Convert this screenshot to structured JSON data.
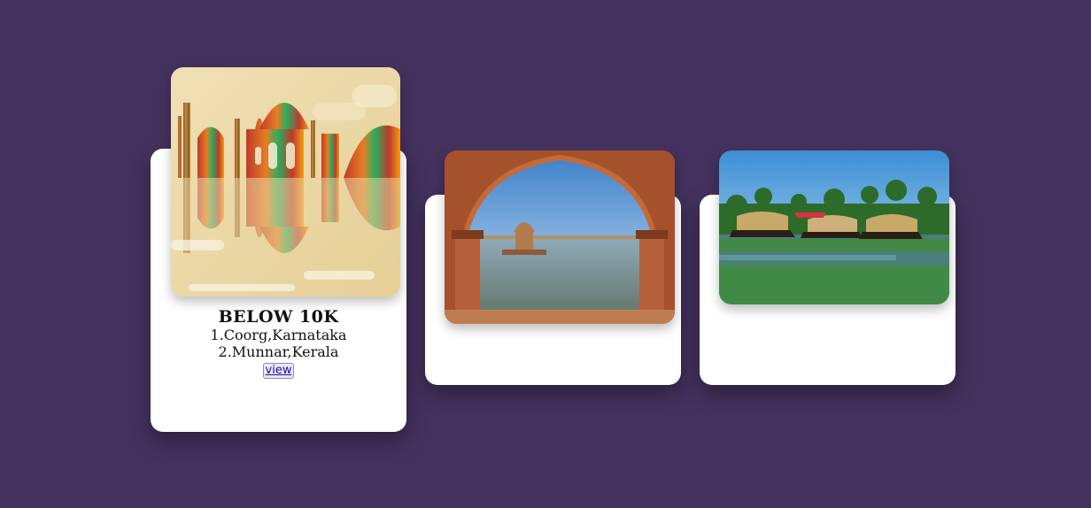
{
  "cards": [
    {
      "title": "BELOW 10K",
      "items": [
        "1.Coorg,Karnataka",
        "2.Munnar,Kerala"
      ],
      "button_label": "view"
    },
    {},
    {}
  ],
  "colors": {
    "background": "#44315d",
    "card": "#ffffff"
  }
}
